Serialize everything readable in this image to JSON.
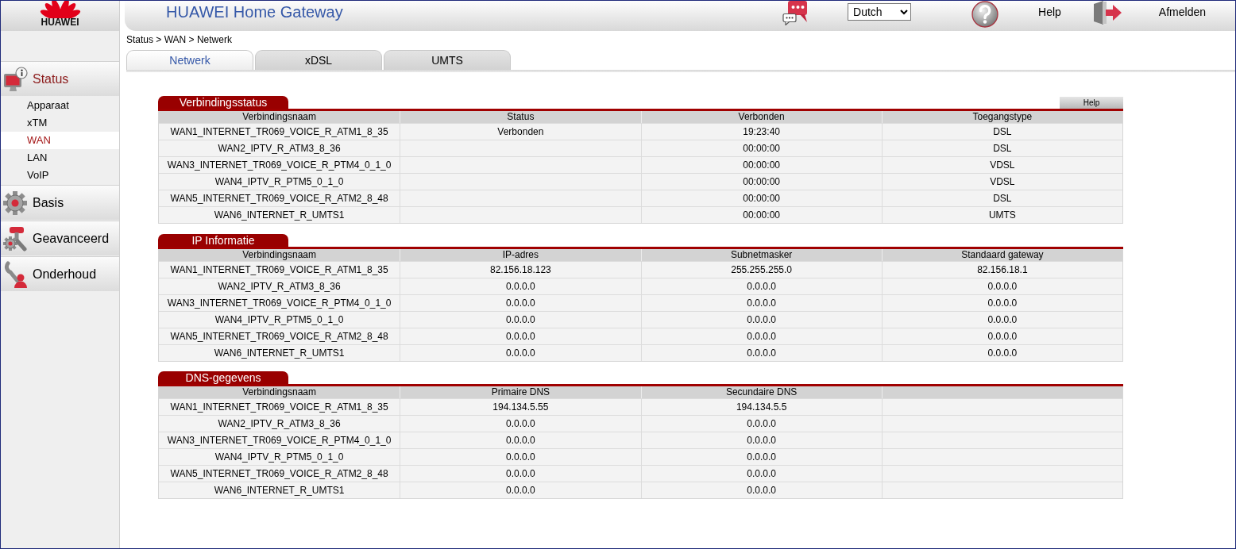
{
  "header": {
    "logo_text": "HUAWEI",
    "title": "HUAWEI Home Gateway",
    "language_select": {
      "value": "Dutch"
    },
    "help_label": "Help",
    "logout_label": "Afmelden"
  },
  "sidebar": {
    "groups": [
      {
        "label": "Status",
        "selected": true,
        "children": [
          {
            "label": "Apparaat",
            "selected": false
          },
          {
            "label": "xTM",
            "selected": false
          },
          {
            "label": "WAN",
            "selected": true
          },
          {
            "label": "LAN",
            "selected": false
          },
          {
            "label": "VoIP",
            "selected": false
          }
        ]
      },
      {
        "label": "Basis",
        "selected": false
      },
      {
        "label": "Geavanceerd",
        "selected": false
      },
      {
        "label": "Onderhoud",
        "selected": false
      }
    ]
  },
  "breadcrumb": "Status > WAN > Netwerk",
  "tabs": [
    {
      "label": "Netwerk",
      "selected": true
    },
    {
      "label": "xDSL",
      "selected": false
    },
    {
      "label": "UMTS",
      "selected": false
    }
  ],
  "sections": [
    {
      "title": "Verbindingsstatus",
      "help_button": "Help",
      "columns": [
        "Verbindingsnaam",
        "Status",
        "Verbonden",
        "Toegangstype"
      ],
      "rows": [
        [
          "WAN1_INTERNET_TR069_VOICE_R_ATM1_8_35",
          "Verbonden",
          "19:23:40",
          "DSL"
        ],
        [
          "WAN2_IPTV_R_ATM3_8_36",
          null,
          "00:00:00",
          "DSL"
        ],
        [
          "WAN3_INTERNET_TR069_VOICE_R_PTM4_0_1_0",
          null,
          "00:00:00",
          "VDSL"
        ],
        [
          "WAN4_IPTV_R_PTM5_0_1_0",
          null,
          "00:00:00",
          "VDSL"
        ],
        [
          "WAN5_INTERNET_TR069_VOICE_R_ATM2_8_48",
          null,
          "00:00:00",
          "DSL"
        ],
        [
          "WAN6_INTERNET_R_UMTS1",
          null,
          "00:00:00",
          "UMTS"
        ]
      ]
    },
    {
      "title": "IP Informatie",
      "columns": [
        "Verbindingsnaam",
        "IP-adres",
        "Subnetmasker",
        "Standaard gateway"
      ],
      "rows": [
        [
          "WAN1_INTERNET_TR069_VOICE_R_ATM1_8_35",
          "82.156.18.123",
          "255.255.255.0",
          "82.156.18.1"
        ],
        [
          "WAN2_IPTV_R_ATM3_8_36",
          "0.0.0.0",
          "0.0.0.0",
          "0.0.0.0"
        ],
        [
          "WAN3_INTERNET_TR069_VOICE_R_PTM4_0_1_0",
          "0.0.0.0",
          "0.0.0.0",
          "0.0.0.0"
        ],
        [
          "WAN4_IPTV_R_PTM5_0_1_0",
          "0.0.0.0",
          "0.0.0.0",
          "0.0.0.0"
        ],
        [
          "WAN5_INTERNET_TR069_VOICE_R_ATM2_8_48",
          "0.0.0.0",
          "0.0.0.0",
          "0.0.0.0"
        ],
        [
          "WAN6_INTERNET_R_UMTS1",
          "0.0.0.0",
          "0.0.0.0",
          "0.0.0.0"
        ]
      ]
    },
    {
      "title": "DNS-gegevens",
      "columns": [
        "Verbindingsnaam",
        "Primaire DNS",
        "Secundaire DNS"
      ],
      "rows": [
        [
          "WAN1_INTERNET_TR069_VOICE_R_ATM1_8_35",
          "194.134.5.55",
          "194.134.5.5"
        ],
        [
          "WAN2_IPTV_R_ATM3_8_36",
          "0.0.0.0",
          "0.0.0.0"
        ],
        [
          "WAN3_INTERNET_TR069_VOICE_R_PTM4_0_1_0",
          "0.0.0.0",
          "0.0.0.0"
        ],
        [
          "WAN4_IPTV_R_PTM5_0_1_0",
          "0.0.0.0",
          "0.0.0.0"
        ],
        [
          "WAN5_INTERNET_TR069_VOICE_R_ATM2_8_48",
          "0.0.0.0",
          "0.0.0.0"
        ],
        [
          "WAN6_INTERNET_R_UMTS1",
          "0.0.0.0",
          "0.0.0.0"
        ]
      ]
    }
  ]
}
